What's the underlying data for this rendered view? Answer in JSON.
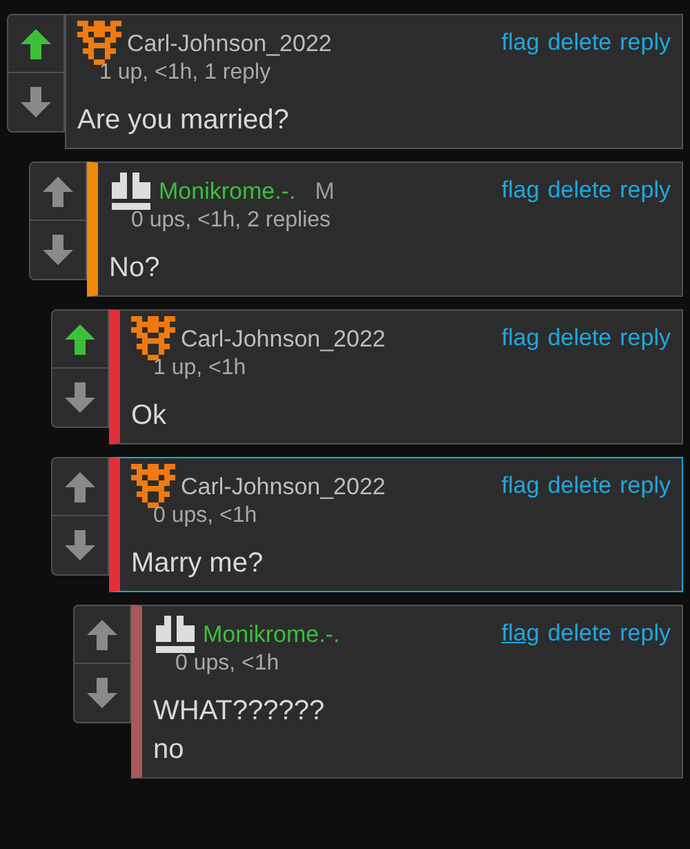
{
  "comments": [
    {
      "author": "Carl-Johnson_2022",
      "kind": "pixel",
      "name_green": false,
      "meta": "1 up, <1h, 1 reply",
      "upvoted": true,
      "selected": false,
      "lines": [
        "Are you married?"
      ],
      "actions": [
        {
          "label": "flag",
          "hovered": false
        },
        {
          "label": "delete",
          "hovered": false
        },
        {
          "label": "reply",
          "hovered": false
        }
      ],
      "children": [
        {
          "author": "Monikrome.-.",
          "kind": "blocks",
          "name_green": true,
          "badge": "M",
          "meta": "0 ups, <1h, 2 replies",
          "upvoted": false,
          "selected": false,
          "color": "#f0880a",
          "lines": [
            "No?"
          ],
          "actions": [
            {
              "label": "flag",
              "hovered": false
            },
            {
              "label": "delete",
              "hovered": false
            },
            {
              "label": "reply",
              "hovered": false
            }
          ],
          "children": [
            {
              "author": "Carl-Johnson_2022",
              "kind": "pixel",
              "name_green": false,
              "meta": "1 up, <1h",
              "upvoted": true,
              "selected": false,
              "color": "#e0303a",
              "lines": [
                "Ok"
              ],
              "actions": [
                {
                  "label": "flag",
                  "hovered": false
                },
                {
                  "label": "delete",
                  "hovered": false
                },
                {
                  "label": "reply",
                  "hovered": false
                }
              ]
            },
            {
              "author": "Carl-Johnson_2022",
              "kind": "pixel",
              "name_green": false,
              "meta": "0 ups, <1h",
              "upvoted": false,
              "selected": true,
              "color": "#e0303a",
              "lines": [
                "Marry me?"
              ],
              "actions": [
                {
                  "label": "flag",
                  "hovered": false
                },
                {
                  "label": "delete",
                  "hovered": false
                },
                {
                  "label": "reply",
                  "hovered": false
                }
              ],
              "children": [
                {
                  "author": "Monikrome.-.",
                  "kind": "blocks",
                  "name_green": true,
                  "meta": "0 ups, <1h",
                  "upvoted": false,
                  "selected": false,
                  "color": "#a85858",
                  "lines": [
                    "WHAT??????",
                    "no"
                  ],
                  "actions": [
                    {
                      "label": "flag",
                      "hovered": true
                    },
                    {
                      "label": "delete",
                      "hovered": false
                    },
                    {
                      "label": "reply",
                      "hovered": false
                    }
                  ]
                }
              ]
            }
          ]
        }
      ]
    }
  ]
}
